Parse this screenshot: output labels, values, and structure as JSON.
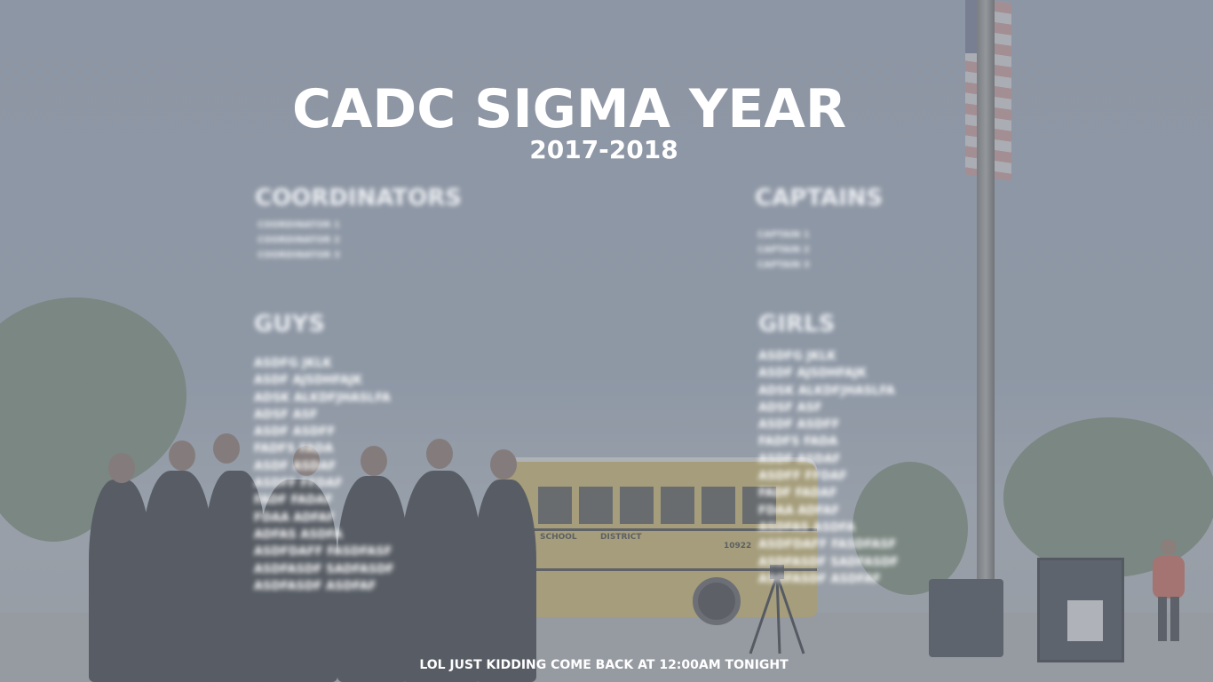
{
  "header": {
    "title": "CADC SIGMA YEAR",
    "subtitle": "2017-2018"
  },
  "coordinators": {
    "heading": "COORDINATORS",
    "items": [
      "COORDINATOR 1",
      "COORDINATOR 2",
      "COORDINATOR 3"
    ]
  },
  "captains": {
    "heading": "CAPTAINS",
    "items": [
      "CAPTAIN 1",
      "CAPTAIN 2",
      "CAPTAIN 3"
    ]
  },
  "guys": {
    "heading": "GUYS",
    "items": [
      "ASDFG JKLK",
      "ASDF AJSDHFAJK",
      "ADSK ALKDFJHASLFA",
      "ADSF ASF",
      "ASDF ASDFF",
      "FADFS FADA",
      "ASDF ASDAF",
      "ASDFF FFDAF",
      "FADF FADAF",
      "FDAA ADFAF",
      "ADFAS ASDFA",
      "ASDFDAFF FASDFASF",
      "ASDFASDF SADFASDF",
      "ASDFASDF ASDFAF"
    ]
  },
  "girls": {
    "heading": "GIRLS",
    "items": [
      "ASDFG JKLK",
      "ASDF AJSDHFAJK",
      "ADSK ALKDFJHASLFA",
      "ADSF ASF",
      "ASDF ASDFF",
      "FADFS FADA",
      "ASDF ASDAF",
      "ASDFF FFDAF",
      "FADF FADAF",
      "FDAA ADFAF",
      "ASDFAS ASDFA",
      "ASDFDAFF FASDFASF",
      "ASDFASDF SADFASDF",
      "ASOFASDF ASDFAF"
    ]
  },
  "background": {
    "bus_label_left": "SCHOOL",
    "bus_label_right": "DISTRICT",
    "bus_number": "10922"
  },
  "footer": {
    "message": "LOL JUST KIDDING COME BACK AT 12:00AM TONIGHT"
  },
  "colors": {
    "text": "#ffffff",
    "overlay": "#8d96a3",
    "bus": "#b7a35e"
  }
}
